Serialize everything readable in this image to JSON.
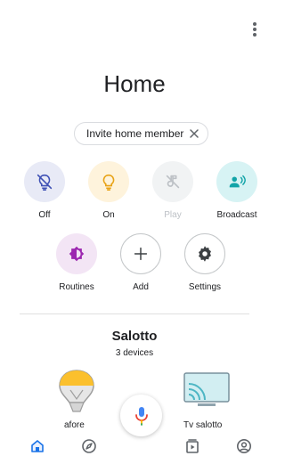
{
  "header": {
    "title": "Home",
    "more_icon": "more-vert-icon"
  },
  "invite_chip": {
    "label": "Invite home member",
    "close_icon": "close-icon"
  },
  "actions": [
    {
      "label": "Off",
      "icon": "lightbulb-off-icon",
      "bg": "#e8eaf6",
      "color": "#3f51b5",
      "enabled": true
    },
    {
      "label": "On",
      "icon": "lightbulb-icon",
      "bg": "#fef3dc",
      "color": "#e8a317",
      "enabled": true
    },
    {
      "label": "Play",
      "icon": "music-off-icon",
      "bg": "#f1f3f4",
      "color": "#bdc1c6",
      "enabled": false
    },
    {
      "label": "Broadcast",
      "icon": "broadcast-icon",
      "bg": "#d7f3f4",
      "color": "#12a4a8",
      "enabled": true
    },
    {
      "label": "Routines",
      "icon": "routines-icon",
      "bg": "#f3e5f5",
      "color": "#9c27b0",
      "enabled": true
    },
    {
      "label": "Add",
      "icon": "plus-icon",
      "bg": "#ffffff",
      "color": "#202124",
      "enabled": true
    },
    {
      "label": "Settings",
      "icon": "gear-icon",
      "bg": "#ffffff",
      "color": "#202124",
      "enabled": true
    }
  ],
  "room": {
    "name": "Salotto",
    "device_count": "3 devices"
  },
  "devices": [
    {
      "name": "afore",
      "icon": "smart-bulb-icon"
    },
    {
      "name": "Tv salotto",
      "icon": "cast-tv-icon"
    }
  ],
  "fab": {
    "icon": "microphone-icon"
  },
  "bottom_nav": [
    {
      "id": "home",
      "icon": "home-icon",
      "active": true
    },
    {
      "id": "discover",
      "icon": "compass-icon",
      "active": false
    },
    {
      "id": "media",
      "icon": "media-icon",
      "active": false
    },
    {
      "id": "account",
      "icon": "account-icon",
      "active": false
    }
  ],
  "colors": {
    "accent": "#1a73e8",
    "text": "#202124",
    "muted": "#5f6368",
    "disabled": "#bdc1c6"
  }
}
